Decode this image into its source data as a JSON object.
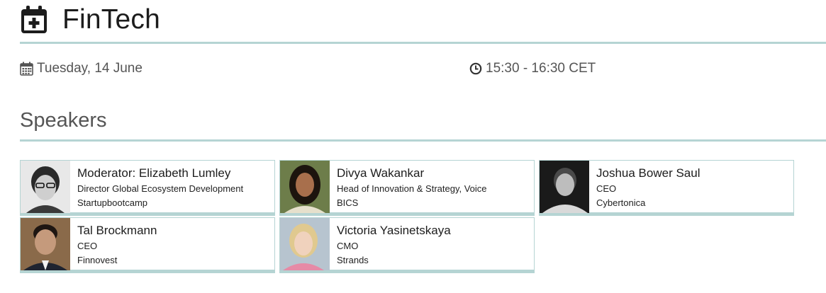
{
  "event": {
    "title": "FinTech",
    "date": "Tuesday, 14 June",
    "time": "15:30 - 16:30 CET"
  },
  "speakers_section": {
    "title": "Speakers",
    "speakers": [
      {
        "name": "Moderator: Elizabeth Lumley",
        "role": "Director Global Ecosystem Development",
        "company": "Startupbootcamp"
      },
      {
        "name": "Divya Wakankar",
        "role": "Head of Innovation & Strategy, Voice",
        "company": "BICS"
      },
      {
        "name": "Joshua Bower Saul",
        "role": "CEO",
        "company": "Cybertonica"
      },
      {
        "name": "Tal Brockmann",
        "role": "CEO",
        "company": "Finnovest"
      },
      {
        "name": "Victoria Yasinetskaya",
        "role": "CMO",
        "company": "Strands"
      }
    ]
  },
  "icons": {
    "title": "calendar-plus-icon",
    "date": "calendar-icon",
    "time": "clock-icon"
  },
  "colors": {
    "accent_rule": "#b5d4d3",
    "heading_text": "#1c1c1c",
    "meta_text": "#555555"
  }
}
